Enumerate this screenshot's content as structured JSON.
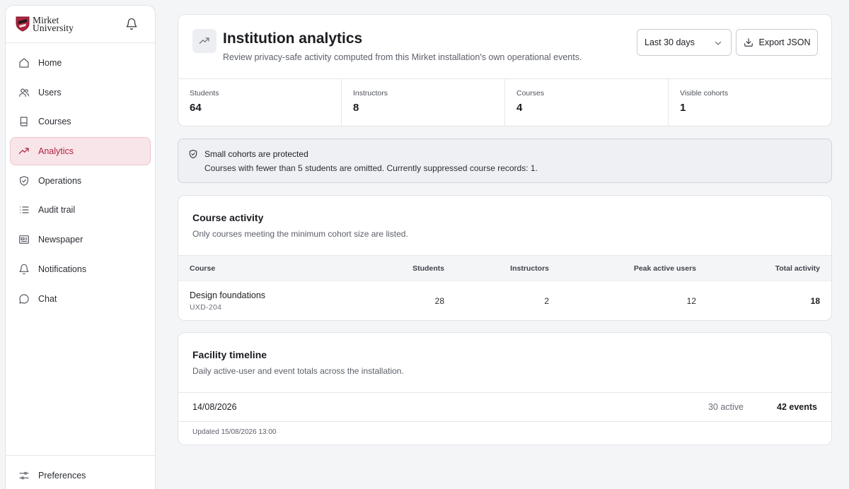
{
  "brand": {
    "line1": "Mirket",
    "line2": "University",
    "primary_color": "#b0223f"
  },
  "sidebar": {
    "items": [
      {
        "label": "Home",
        "icon": "home-icon"
      },
      {
        "label": "Users",
        "icon": "users-icon"
      },
      {
        "label": "Courses",
        "icon": "book-icon"
      },
      {
        "label": "Analytics",
        "icon": "trending-up-icon",
        "active": true
      },
      {
        "label": "Operations",
        "icon": "shield-check-icon"
      },
      {
        "label": "Audit trail",
        "icon": "list-icon"
      },
      {
        "label": "Newspaper",
        "icon": "newspaper-icon"
      },
      {
        "label": "Notifications",
        "icon": "bell-icon"
      },
      {
        "label": "Chat",
        "icon": "message-icon"
      }
    ],
    "footer": {
      "label": "Preferences",
      "icon": "sliders-icon"
    }
  },
  "header": {
    "title": "Institution analytics",
    "subtitle": "Review privacy-safe activity computed from this Mirket installation's own operational events.",
    "range": "Last 30 days",
    "export_label": "Export JSON"
  },
  "stats": [
    {
      "label": "Students",
      "value": "64"
    },
    {
      "label": "Instructors",
      "value": "8"
    },
    {
      "label": "Courses",
      "value": "4"
    },
    {
      "label": "Visible cohorts",
      "value": "1"
    }
  ],
  "notice": {
    "title": "Small cohorts are protected",
    "text": "Courses with fewer than 5 students are omitted. Currently suppressed course records: 1."
  },
  "course_activity": {
    "title": "Course activity",
    "subtitle": "Only courses meeting the minimum cohort size are listed.",
    "columns": {
      "course": "Course",
      "students": "Students",
      "instructors": "Instructors",
      "peak": "Peak active users",
      "total": "Total activity"
    },
    "rows": [
      {
        "name": "Design foundations",
        "code": "UXD-204",
        "students": "28",
        "instructors": "2",
        "peak": "12",
        "total": "18"
      }
    ]
  },
  "timeline": {
    "title": "Facility timeline",
    "subtitle": "Daily active-user and event totals across the installation.",
    "rows": [
      {
        "date": "14/08/2026",
        "active": "30 active",
        "events": "42 events"
      }
    ],
    "updated": "Updated 15/08/2026 13:00"
  }
}
